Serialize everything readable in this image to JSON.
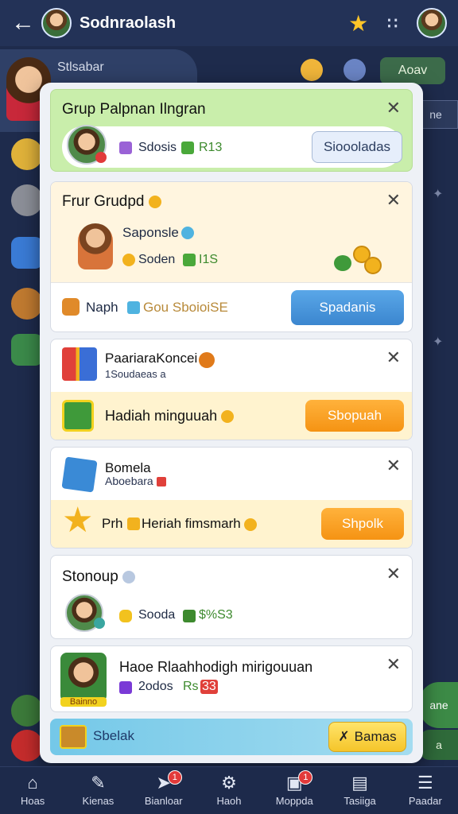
{
  "app": {
    "title": "Sodnraolash"
  },
  "background": {
    "user_name": "Stlsabar",
    "pill_top": "Aoav",
    "pill_side": "ne",
    "green_pill": "ane",
    "green_pill2": "a"
  },
  "cards": [
    {
      "title": "Grup Palpnan Ilngran",
      "info_a": "Sdosis",
      "info_b": "R13",
      "button": "Sioooladas"
    },
    {
      "title": "Frur Grudpd",
      "name": "Saponsle",
      "info_a": "Soden",
      "info_b": "I1S",
      "row_a": "Naph",
      "row_b": "Gou SboioiSE",
      "button": "Spadanis"
    },
    {
      "title": "PaariaraKoncei",
      "subtitle": "1Soudaeas a",
      "row_text": "Hadiah minguuah",
      "button": "Sbopuah"
    },
    {
      "title": "Bomela",
      "subtitle": "Aboebara",
      "row_a": "Prh",
      "row_b": "Heriah fimsmarh",
      "button": "Shpolk"
    },
    {
      "title": "Stonoup",
      "info_a": "Sooda",
      "info_b": "$%S3"
    },
    {
      "title": "Haoe Rlaahhodigh mirigouuan",
      "info_a": "2odos",
      "info_b": "Rs",
      "info_c": "33",
      "img_label": "Bainno"
    }
  ],
  "footer": {
    "label": "Sbelak",
    "button": "Bamas"
  },
  "nav": [
    {
      "label": "Hoas",
      "icon": "home-icon"
    },
    {
      "label": "Kienas",
      "icon": "edit-icon"
    },
    {
      "label": "Bianloar",
      "icon": "arrow-icon",
      "badge": "1"
    },
    {
      "label": "Haoh",
      "icon": "gear-icon"
    },
    {
      "label": "Moppda",
      "icon": "card-icon",
      "badge": "1"
    },
    {
      "label": "Tasiiga",
      "icon": "folder-icon"
    },
    {
      "label": "Paadar",
      "icon": "menu-icon"
    }
  ]
}
